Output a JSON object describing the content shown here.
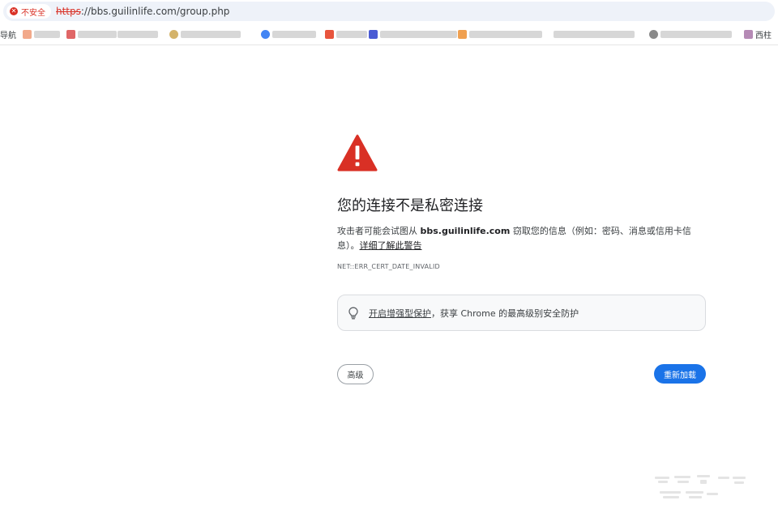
{
  "address_bar": {
    "security_label": "不安全",
    "url_scheme": "https",
    "url_rest": "://bbs.guilinlife.com/group.php"
  },
  "bookmarks": {
    "first_label": "导航",
    "last_label": "西柱"
  },
  "interstitial": {
    "heading": "您的连接不是私密连接",
    "explanation_prefix": "攻击者可能会试图从 ",
    "host": "bbs.guilinlife.com",
    "explanation_suffix": " 窃取您的信息（例如：密码、消息或信用卡信息）。",
    "learn_more": "详细了解此警告",
    "error_code": "NET::ERR_CERT_DATE_INVALID",
    "protection_link": "开启增强型保护",
    "protection_rest": "，获享 Chrome 的最高级别安全防护",
    "advanced_label": "高级",
    "reload_label": "重新加载"
  },
  "colors": {
    "warning_red": "#d93025",
    "primary_blue": "#1a73e8",
    "text_dark": "#202124"
  },
  "icons": {
    "security": "warning-circle-icon",
    "warning": "warning-triangle-icon",
    "protection": "lightbulb-icon"
  }
}
